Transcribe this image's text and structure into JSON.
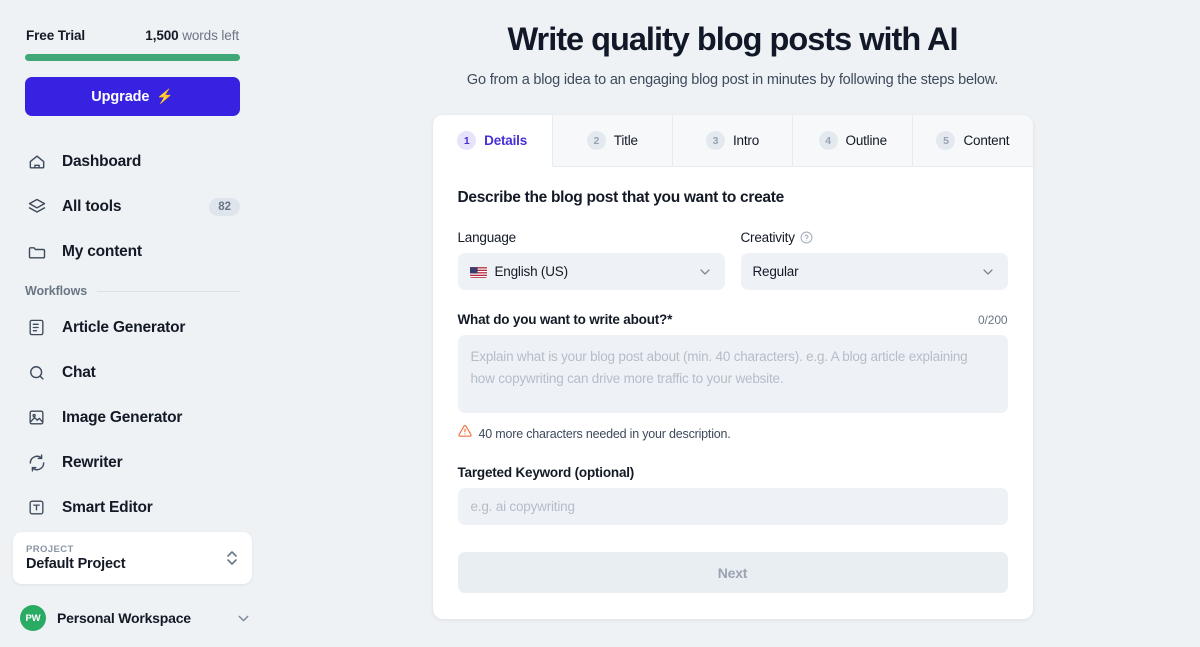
{
  "sidebar": {
    "trial": {
      "plan_label": "Free Trial",
      "words_amount": "1,500",
      "words_suffix": " words left",
      "progress_percent": 100
    },
    "upgrade": {
      "label": "Upgrade",
      "icon": "⚡"
    },
    "nav_items": [
      {
        "label": "Dashboard",
        "icon": "home-icon",
        "badge": ""
      },
      {
        "label": "All tools",
        "icon": "layers-icon",
        "badge": "82"
      },
      {
        "label": "My content",
        "icon": "folder-icon",
        "badge": ""
      }
    ],
    "section_label": "Workflows",
    "workflow_items": [
      {
        "label": "Article Generator",
        "icon": "document-icon"
      },
      {
        "label": "Chat",
        "icon": "chat-icon"
      },
      {
        "label": "Image Generator",
        "icon": "image-icon"
      },
      {
        "label": "Rewriter",
        "icon": "refresh-icon"
      },
      {
        "label": "Smart Editor",
        "icon": "text-editor-icon"
      }
    ],
    "project": {
      "kicker": "PROJECT",
      "name": "Default Project"
    },
    "workspace": {
      "initials": "PW",
      "name": "Personal Workspace"
    }
  },
  "main": {
    "title": "Write quality blog posts with AI",
    "subtitle": "Go from a blog idea to an engaging blog post in minutes by following the steps below.",
    "tabs": [
      {
        "num": "1",
        "label": "Details",
        "active": true
      },
      {
        "num": "2",
        "label": "Title",
        "active": false
      },
      {
        "num": "3",
        "label": "Intro",
        "active": false
      },
      {
        "num": "4",
        "label": "Outline",
        "active": false
      },
      {
        "num": "5",
        "label": "Content",
        "active": false
      }
    ],
    "form": {
      "heading": "Describe the blog post that you want to create",
      "language_label": "Language",
      "language_value": "English (US)",
      "creativity_label": "Creativity",
      "creativity_value": "Regular",
      "about_label": "What do you want to write about?*",
      "about_counter": "0/200",
      "about_placeholder": "Explain what is your blog post about (min. 40 characters). e.g. A blog article explaining how copywriting can drive more traffic to your website.",
      "about_warning": "40 more characters needed in your description.",
      "keyword_label": "Targeted Keyword (optional)",
      "keyword_placeholder": "e.g. ai copywriting",
      "next_label": "Next"
    }
  },
  "colors": {
    "accent": "#3822e2",
    "tab_active": "#4430d6",
    "progress": "#40a877",
    "avatar": "#2aab64",
    "warning": "#f0703c",
    "page_bg": "#eef2f5"
  }
}
